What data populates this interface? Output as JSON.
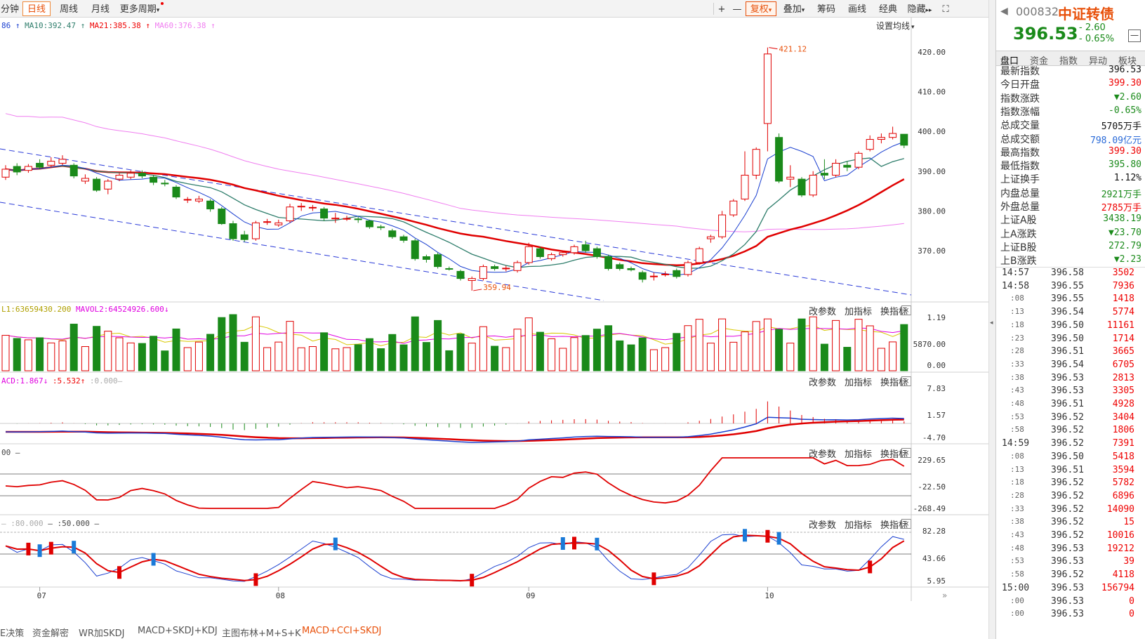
{
  "toolbar": {
    "periods": [
      {
        "label": "分钟",
        "active": false
      },
      {
        "label": "日线",
        "active": true
      },
      {
        "label": "周线",
        "active": false
      },
      {
        "label": "月线",
        "active": false
      },
      {
        "label": "更多周期",
        "active": false
      }
    ],
    "right_buttons": [
      "+",
      "—",
      "复权",
      "叠加",
      "筹码",
      "画线",
      "经典",
      "隐藏",
      "⛶"
    ],
    "dropdown_arrow": "▾",
    "hide_arrow": "▸▸"
  },
  "main_legend": {
    "ma5": "86",
    "ma10": "MA10:392.47",
    "ma21": "MA21:385.38",
    "ma60": "MA60:376.38",
    "set_ma": "设置均线"
  },
  "vol_legend": {
    "l1": "L1:63659430.200",
    "l2": "MAVOL2:64524926.600"
  },
  "macd_legend": {
    "a": "ACD:1.867",
    "b": ":5.532",
    "c": ":0.000"
  },
  "cci_legend": {
    "a": "00"
  },
  "kdj_legend": {
    "a": ":80.000",
    "b": ":50.000"
  },
  "panel_tools": [
    "改参数",
    "加指标",
    "换指标"
  ],
  "y_axes": {
    "main": [
      "420.00",
      "410.00",
      "400.00",
      "390.00",
      "380.00",
      "370.00"
    ],
    "vol": [
      "1.19",
      "5870.00",
      "0.00"
    ],
    "macd": [
      "7.83",
      "1.57",
      "-4.70"
    ],
    "cci": [
      "229.65",
      "-22.50",
      "-268.49"
    ],
    "kdj": [
      "82.28",
      "43.66",
      "5.95"
    ]
  },
  "x_labels": [
    "07",
    "08",
    "09",
    "10"
  ],
  "bottom_tabs": [
    {
      "label": "E决策",
      "active": false
    },
    {
      "label": "资金解密",
      "active": false
    },
    {
      "label": "WR加SKDJ",
      "active": false
    },
    {
      "label": "MACD+SKDJ+KDJ",
      "active": false
    },
    {
      "label": "主图布林+M+S+K",
      "active": false
    },
    {
      "label": "MACD+CCI+SKDJ",
      "active": true
    }
  ],
  "quote": {
    "code": "000832",
    "name": "中证转债",
    "price": "396.53",
    "change": "- 2.60",
    "change_pct": "- 0.65%",
    "tabs": [
      "盘口",
      "资金",
      "指数",
      "异动",
      "板块"
    ],
    "fields": [
      {
        "k": "最新指数",
        "v": "396.53",
        "c": "black"
      },
      {
        "k": "今日开盘",
        "v": "399.30",
        "c": "red"
      },
      {
        "k": "指数涨跌",
        "v": "▼2.60",
        "c": "green"
      },
      {
        "k": "指数涨幅",
        "v": "-0.65%",
        "c": "green"
      },
      {
        "k": "总成交量",
        "v": "5705万手",
        "c": "black"
      },
      {
        "k": "总成交额",
        "v": "798.09亿元",
        "c": "blue"
      },
      {
        "k": "最高指数",
        "v": "399.30",
        "c": "red"
      },
      {
        "k": "最低指数",
        "v": "395.80",
        "c": "green"
      },
      {
        "k": "上证换手",
        "v": "1.12%",
        "c": "black"
      },
      {
        "k": "内盘总量",
        "v": "2921万手",
        "c": "green"
      },
      {
        "k": "外盘总量",
        "v": "2785万手",
        "c": "red"
      },
      {
        "k": "上证A股",
        "v": "3438.19",
        "c": "green"
      },
      {
        "k": "上A涨跌",
        "v": "▼23.70",
        "c": "green"
      },
      {
        "k": "上证B股",
        "v": "272.79",
        "c": "green"
      },
      {
        "k": "上B涨跌",
        "v": "▼2.23",
        "c": "green"
      }
    ],
    "ticks": [
      {
        "t": "14:57",
        "p": "396.58",
        "v": "3502",
        "bold": true
      },
      {
        "t": "14:58",
        "p": "396.55",
        "v": "7936",
        "bold": true
      },
      {
        "t": ":08",
        "p": "396.55",
        "v": "1418"
      },
      {
        "t": ":13",
        "p": "396.54",
        "v": "5774"
      },
      {
        "t": ":18",
        "p": "396.50",
        "v": "11161"
      },
      {
        "t": ":23",
        "p": "396.50",
        "v": "1714"
      },
      {
        "t": ":28",
        "p": "396.51",
        "v": "3665"
      },
      {
        "t": ":33",
        "p": "396.54",
        "v": "6705"
      },
      {
        "t": ":38",
        "p": "396.53",
        "v": "2813"
      },
      {
        "t": ":43",
        "p": "396.53",
        "v": "3305"
      },
      {
        "t": ":48",
        "p": "396.51",
        "v": "4928"
      },
      {
        "t": ":53",
        "p": "396.52",
        "v": "3404"
      },
      {
        "t": ":58",
        "p": "396.52",
        "v": "1806"
      },
      {
        "t": "14:59",
        "p": "396.52",
        "v": "7391",
        "bold": true
      },
      {
        "t": ":08",
        "p": "396.50",
        "v": "5418"
      },
      {
        "t": ":13",
        "p": "396.51",
        "v": "3594"
      },
      {
        "t": ":18",
        "p": "396.52",
        "v": "5782"
      },
      {
        "t": ":28",
        "p": "396.52",
        "v": "6896"
      },
      {
        "t": ":33",
        "p": "396.52",
        "v": "14090"
      },
      {
        "t": ":38",
        "p": "396.52",
        "v": "15"
      },
      {
        "t": ":43",
        "p": "396.52",
        "v": "10016"
      },
      {
        "t": ":48",
        "p": "396.53",
        "v": "19212"
      },
      {
        "t": ":53",
        "p": "396.53",
        "v": "39"
      },
      {
        "t": ":58",
        "p": "396.52",
        "v": "4118"
      },
      {
        "t": "15:00",
        "p": "396.53",
        "v": "156794",
        "bold": true
      },
      {
        "t": ":00",
        "p": "396.53",
        "v": "0"
      },
      {
        "t": ":00",
        "p": "396.53",
        "v": "0"
      }
    ]
  },
  "colors": {
    "up": "#e00000",
    "down": "#1a8a1a",
    "ma5": "#1a3fd0",
    "ma10": "#2e7d6b",
    "ma21": "#e00000",
    "ma60": "#f07ef0",
    "channel": "#2a3ad8",
    "accent": "#e8500a"
  },
  "chart_data": {
    "type": "candlestick",
    "title": "",
    "ylim": [
      359,
      423
    ],
    "annotations": [
      {
        "label": "421.12",
        "kind": "high"
      },
      {
        "label": "359.94",
        "kind": "low"
      }
    ],
    "candles": [
      {
        "o": 388.5,
        "c": 390.5,
        "h": 391.5,
        "l": 387.8
      },
      {
        "o": 391.2,
        "c": 389.8,
        "h": 392.0,
        "l": 389.0
      },
      {
        "o": 390.2,
        "c": 391.2,
        "h": 391.8,
        "l": 389.6
      },
      {
        "o": 392.0,
        "c": 391.0,
        "h": 393.0,
        "l": 390.5
      },
      {
        "o": 391.5,
        "c": 392.5,
        "h": 393.5,
        "l": 391.0
      },
      {
        "o": 392.0,
        "c": 393.0,
        "h": 394.0,
        "l": 391.5
      },
      {
        "o": 391.5,
        "c": 388.8,
        "h": 392.0,
        "l": 388.2
      },
      {
        "o": 387.5,
        "c": 388.2,
        "h": 389.2,
        "l": 386.8
      },
      {
        "o": 388.0,
        "c": 385.2,
        "h": 388.5,
        "l": 384.8
      },
      {
        "o": 385.5,
        "c": 387.5,
        "h": 388.0,
        "l": 384.2
      },
      {
        "o": 388.0,
        "c": 389.0,
        "h": 389.5,
        "l": 387.5
      },
      {
        "o": 388.5,
        "c": 389.5,
        "h": 390.2,
        "l": 388.0
      },
      {
        "o": 389.5,
        "c": 388.8,
        "h": 390.2,
        "l": 388.2
      },
      {
        "o": 388.5,
        "c": 387.2,
        "h": 389.0,
        "l": 386.5
      },
      {
        "o": 387.0,
        "c": 386.8,
        "h": 387.8,
        "l": 386.2
      },
      {
        "o": 386.0,
        "c": 383.5,
        "h": 386.5,
        "l": 383.0
      },
      {
        "o": 382.8,
        "c": 382.9,
        "h": 383.5,
        "l": 382.0
      },
      {
        "o": 382.5,
        "c": 383.0,
        "h": 383.8,
        "l": 382.0
      },
      {
        "o": 382.5,
        "c": 380.5,
        "h": 383.0,
        "l": 379.8
      },
      {
        "o": 380.5,
        "c": 376.8,
        "h": 381.0,
        "l": 376.5
      },
      {
        "o": 376.8,
        "c": 373.0,
        "h": 377.5,
        "l": 372.5
      },
      {
        "o": 374.0,
        "c": 372.8,
        "h": 375.0,
        "l": 372.2
      },
      {
        "o": 373.0,
        "c": 377.0,
        "h": 377.5,
        "l": 372.5
      },
      {
        "o": 377.2,
        "c": 377.3,
        "h": 378.0,
        "l": 376.5
      },
      {
        "o": 376.5,
        "c": 377.0,
        "h": 377.8,
        "l": 376.0
      },
      {
        "o": 377.5,
        "c": 381.0,
        "h": 381.8,
        "l": 377.0
      },
      {
        "o": 381.0,
        "c": 381.2,
        "h": 382.0,
        "l": 380.0
      },
      {
        "o": 380.8,
        "c": 380.9,
        "h": 381.5,
        "l": 380.0
      },
      {
        "o": 380.5,
        "c": 378.2,
        "h": 381.0,
        "l": 377.5
      },
      {
        "o": 378.0,
        "c": 378.2,
        "h": 379.5,
        "l": 377.0
      },
      {
        "o": 378.0,
        "c": 378.1,
        "h": 378.8,
        "l": 377.5
      },
      {
        "o": 378.0,
        "c": 377.8,
        "h": 378.5,
        "l": 377.0
      },
      {
        "o": 377.5,
        "c": 376.0,
        "h": 377.8,
        "l": 375.5
      },
      {
        "o": 376.0,
        "c": 375.9,
        "h": 376.5,
        "l": 375.2
      },
      {
        "o": 375.0,
        "c": 373.5,
        "h": 375.5,
        "l": 373.0
      },
      {
        "o": 373.5,
        "c": 372.6,
        "h": 374.0,
        "l": 372.0
      },
      {
        "o": 372.5,
        "c": 368.0,
        "h": 373.0,
        "l": 367.5
      },
      {
        "o": 368.5,
        "c": 367.8,
        "h": 369.0,
        "l": 367.0
      },
      {
        "o": 369.0,
        "c": 366.0,
        "h": 369.5,
        "l": 365.5
      },
      {
        "o": 365.5,
        "c": 365.4,
        "h": 366.0,
        "l": 365.0
      },
      {
        "o": 364.8,
        "c": 363.0,
        "h": 365.2,
        "l": 362.5
      },
      {
        "o": 362.5,
        "c": 363.0,
        "h": 363.5,
        "l": 359.94
      },
      {
        "o": 363.0,
        "c": 366.0,
        "h": 366.5,
        "l": 362.5
      },
      {
        "o": 366.0,
        "c": 365.5,
        "h": 366.5,
        "l": 365.0
      },
      {
        "o": 365.5,
        "c": 365.6,
        "h": 366.2,
        "l": 364.8
      },
      {
        "o": 365.0,
        "c": 367.0,
        "h": 367.5,
        "l": 364.5
      },
      {
        "o": 367.0,
        "c": 371.0,
        "h": 372.0,
        "l": 366.5
      },
      {
        "o": 370.5,
        "c": 368.5,
        "h": 371.0,
        "l": 368.0
      },
      {
        "o": 368.0,
        "c": 369.0,
        "h": 369.5,
        "l": 367.5
      },
      {
        "o": 369.0,
        "c": 369.5,
        "h": 370.0,
        "l": 368.5
      },
      {
        "o": 369.5,
        "c": 371.0,
        "h": 371.5,
        "l": 369.0
      },
      {
        "o": 371.5,
        "c": 370.0,
        "h": 372.5,
        "l": 369.5
      },
      {
        "o": 370.5,
        "c": 368.5,
        "h": 371.0,
        "l": 368.0
      },
      {
        "o": 368.5,
        "c": 365.5,
        "h": 369.0,
        "l": 365.0
      },
      {
        "o": 366.5,
        "c": 365.5,
        "h": 367.0,
        "l": 365.0
      },
      {
        "o": 365.5,
        "c": 365.2,
        "h": 366.0,
        "l": 364.8
      },
      {
        "o": 364.5,
        "c": 362.8,
        "h": 365.0,
        "l": 362.0
      },
      {
        "o": 363.5,
        "c": 363.6,
        "h": 364.5,
        "l": 362.5
      },
      {
        "o": 364.0,
        "c": 364.1,
        "h": 364.8,
        "l": 363.5
      },
      {
        "o": 365.0,
        "c": 363.5,
        "h": 365.5,
        "l": 363.0
      },
      {
        "o": 364.0,
        "c": 367.0,
        "h": 367.5,
        "l": 363.5
      },
      {
        "o": 367.0,
        "c": 370.5,
        "h": 371.0,
        "l": 366.5
      },
      {
        "o": 373.0,
        "c": 373.5,
        "h": 374.0,
        "l": 372.0
      },
      {
        "o": 373.5,
        "c": 379.0,
        "h": 380.0,
        "l": 373.0
      },
      {
        "o": 379.0,
        "c": 382.5,
        "h": 383.0,
        "l": 378.5
      },
      {
        "o": 383.0,
        "c": 389.0,
        "h": 395.0,
        "l": 382.5
      },
      {
        "o": 389.0,
        "c": 395.5,
        "h": 396.0,
        "l": 388.0
      },
      {
        "o": 402.0,
        "c": 419.5,
        "h": 421.12,
        "l": 395.0
      },
      {
        "o": 398.5,
        "c": 387.5,
        "h": 399.5,
        "l": 387.0
      },
      {
        "o": 388.0,
        "c": 388.5,
        "h": 391.5,
        "l": 386.0
      },
      {
        "o": 388.0,
        "c": 384.0,
        "h": 388.5,
        "l": 383.5
      },
      {
        "o": 384.0,
        "c": 389.0,
        "h": 390.0,
        "l": 383.5
      },
      {
        "o": 389.5,
        "c": 389.0,
        "h": 393.0,
        "l": 388.0
      },
      {
        "o": 389.0,
        "c": 392.0,
        "h": 393.0,
        "l": 388.5
      },
      {
        "o": 391.5,
        "c": 391.0,
        "h": 392.5,
        "l": 390.0
      },
      {
        "o": 391.0,
        "c": 394.5,
        "h": 395.0,
        "l": 390.5
      },
      {
        "o": 395.5,
        "c": 398.0,
        "h": 399.0,
        "l": 395.0
      },
      {
        "o": 398.0,
        "c": 398.5,
        "h": 399.5,
        "l": 397.0
      },
      {
        "o": 398.5,
        "c": 399.5,
        "h": 401.2,
        "l": 398.0
      },
      {
        "o": 399.3,
        "c": 396.53,
        "h": 399.3,
        "l": 395.8
      }
    ]
  }
}
